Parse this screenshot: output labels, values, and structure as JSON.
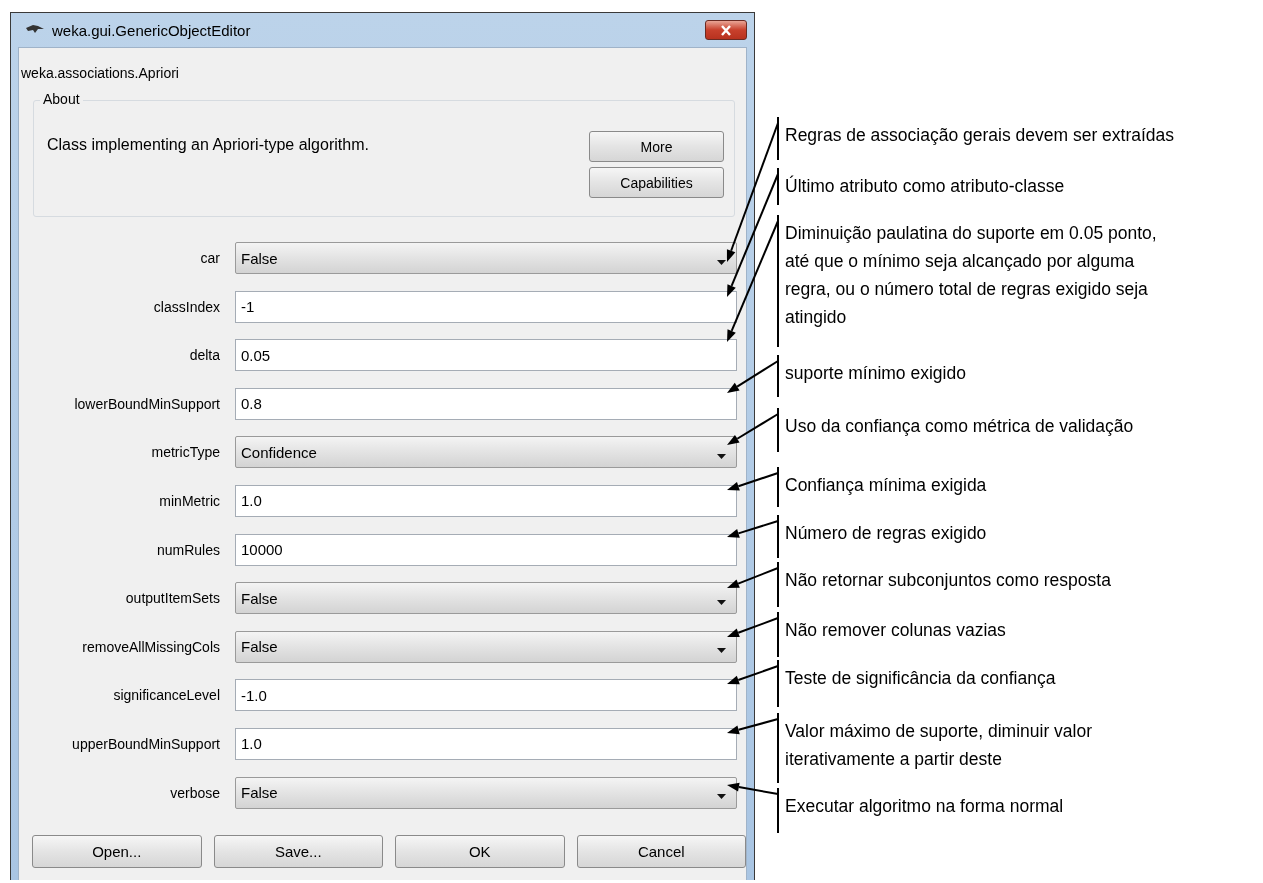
{
  "window": {
    "title": "weka.gui.GenericObjectEditor"
  },
  "subtitle": "weka.associations.Apriori",
  "about": {
    "legend": "About",
    "text": "Class implementing an Apriori-type algorithm.",
    "buttons": [
      "More",
      "Capabilities"
    ]
  },
  "properties": [
    {
      "label": "car",
      "kind": "dropdown",
      "value": "False",
      "annotation": [
        "Regras de associação gerais devem ser extraídas"
      ]
    },
    {
      "label": "classIndex",
      "kind": "text",
      "value": "-1",
      "annotation": [
        "Último atributo como atributo-classe"
      ]
    },
    {
      "label": "delta",
      "kind": "text",
      "value": "0.05",
      "annotation": [
        "Diminuição paulatina do suporte em 0.05 ponto,",
        "até que o mínimo seja alcançado por alguma",
        "regra, ou o número total de regras exigido seja",
        "atingido"
      ]
    },
    {
      "label": "lowerBoundMinSupport",
      "kind": "text",
      "value": "0.8",
      "annotation": [
        "suporte mínimo exigido"
      ]
    },
    {
      "label": "metricType",
      "kind": "dropdown",
      "value": "Confidence",
      "annotation": [
        "Uso da confiança como métrica de validação"
      ]
    },
    {
      "label": "minMetric",
      "kind": "text",
      "value": "1.0",
      "annotation": [
        "Confiança mínima exigida"
      ]
    },
    {
      "label": "numRules",
      "kind": "text",
      "value": "10000",
      "annotation": [
        "Número de regras exigido"
      ]
    },
    {
      "label": "outputItemSets",
      "kind": "dropdown",
      "value": "False",
      "annotation": [
        "Não retornar subconjuntos como resposta"
      ]
    },
    {
      "label": "removeAllMissingCols",
      "kind": "dropdown",
      "value": "False",
      "annotation": [
        "Não remover colunas vazias"
      ]
    },
    {
      "label": "significanceLevel",
      "kind": "text",
      "value": "-1.0",
      "annotation": [
        "Teste de significância da confiança"
      ]
    },
    {
      "label": "upperBoundMinSupport",
      "kind": "text",
      "value": "1.0",
      "annotation": [
        "Valor máximo de suporte, diminuir valor",
        "iterativamente a partir deste"
      ]
    },
    {
      "label": "verbose",
      "kind": "dropdown",
      "value": "False",
      "annotation": [
        "Executar algoritmo na forma normal"
      ]
    }
  ],
  "buttons": [
    "Open...",
    "Save...",
    "OK",
    "Cancel"
  ]
}
